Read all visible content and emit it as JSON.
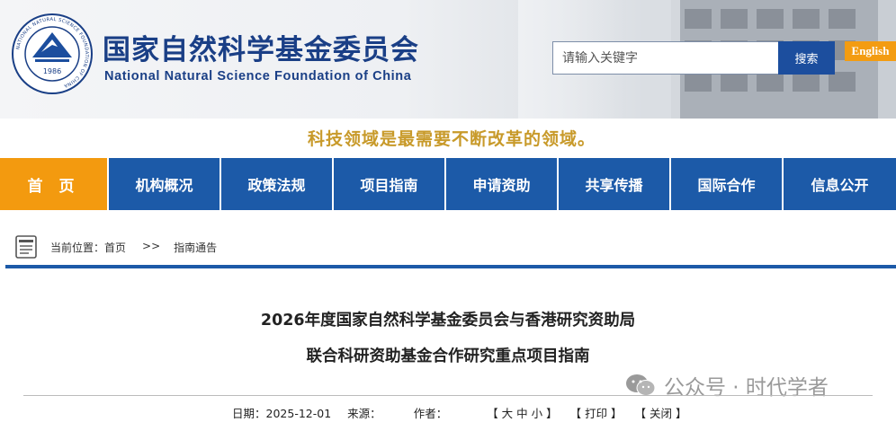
{
  "header": {
    "logo": {
      "year": "1986",
      "ring_text": "NATIONAL NATURAL SCIENCE FOUNDATION OF CHINA",
      "colors": {
        "ring": "#1a3f86",
        "inner": "#1c4e9e"
      }
    },
    "cn_name": "国家自然科学基金委员会",
    "en_name": "National Natural Science Foundation of China",
    "search": {
      "placeholder": "请输入关键字",
      "value": "",
      "button_label": "搜索"
    },
    "english_label": "English"
  },
  "slogan": "科技领域是最需要不断改革的领域。",
  "nav": {
    "items": [
      {
        "label": "首 页",
        "active": true
      },
      {
        "label": "机构概况"
      },
      {
        "label": "政策法规"
      },
      {
        "label": "项目指南"
      },
      {
        "label": "申请资助"
      },
      {
        "label": "共享传播"
      },
      {
        "label": "国际合作"
      },
      {
        "label": "信息公开"
      }
    ]
  },
  "breadcrumb": {
    "prefix": "当前位置：",
    "home": "首页",
    "separator": ">>",
    "current": "指南通告"
  },
  "article": {
    "title_line1": "2026年度国家自然科学基金委员会与香港研究资助局",
    "title_line2": "联合科研资助基金合作研究重点项目指南",
    "meta": {
      "date_label": "日期：",
      "date": "2025-12-01",
      "source_label": "来源：",
      "author_label": "作者：",
      "font_size_control": "【 大 中 小 】",
      "print_label": "【 打印 】",
      "close_label": "【 关闭 】"
    }
  },
  "watermark": {
    "text": "公众号 · 时代学者",
    "icon": "wechat-icon"
  },
  "colors": {
    "brand_blue": "#1c5aa8",
    "title_blue": "#1a3f86",
    "orange": "#f39a0f",
    "slogan_gold": "#c89a2a"
  }
}
